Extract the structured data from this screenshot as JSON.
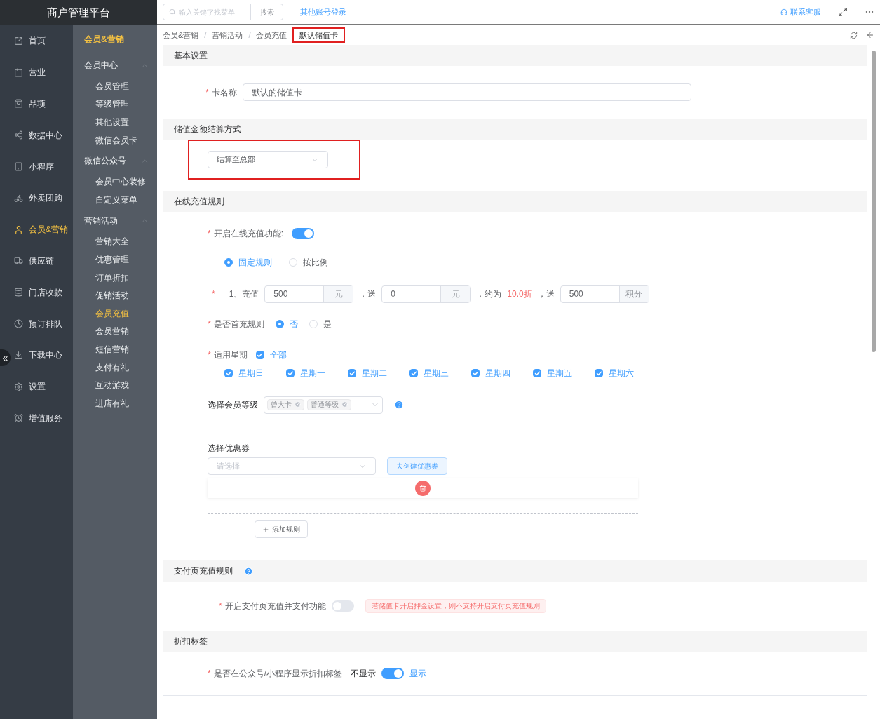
{
  "app_title": "商户管理平台",
  "required_mark": "*",
  "breadcrumb_separator": "/",
  "search": {
    "placeholder": "输入关键字找菜单",
    "button": "搜索"
  },
  "other_login": "其他账号登录",
  "support": "联系客服",
  "nav": [
    {
      "label": "首页",
      "selected": false
    },
    {
      "label": "营业",
      "selected": false
    },
    {
      "label": "品项",
      "selected": false
    },
    {
      "label": "数据中心",
      "selected": false
    },
    {
      "label": "小程序",
      "selected": false
    },
    {
      "label": "外卖团购",
      "selected": false
    },
    {
      "label": "会员&营销",
      "selected": true
    },
    {
      "label": "供应链",
      "selected": false
    },
    {
      "label": "门店收款",
      "selected": false
    },
    {
      "label": "预订排队",
      "selected": false
    },
    {
      "label": "下载中心",
      "selected": false
    },
    {
      "label": "设置",
      "selected": false
    },
    {
      "label": "增值服务",
      "selected": false
    }
  ],
  "collapse_glyph": "«",
  "submenu": {
    "title": "会员&营销",
    "groups": [
      {
        "label": "会员中心",
        "expanded": true,
        "children": [
          {
            "label": "会员管理",
            "selected": false
          },
          {
            "label": "等级管理",
            "selected": false
          },
          {
            "label": "其他设置",
            "selected": false
          },
          {
            "label": "微信会员卡",
            "selected": false
          }
        ]
      },
      {
        "label": "微信公众号",
        "expanded": true,
        "children": [
          {
            "label": "会员中心装修",
            "selected": false
          },
          {
            "label": "自定义菜单",
            "selected": false
          }
        ]
      },
      {
        "label": "营销活动",
        "expanded": true,
        "children": [
          {
            "label": "营销大全",
            "selected": false
          },
          {
            "label": "优惠管理",
            "selected": false
          },
          {
            "label": "订单折扣",
            "selected": false
          },
          {
            "label": "促销活动",
            "selected": false
          },
          {
            "label": "会员充值",
            "selected": true
          },
          {
            "label": "会员营销",
            "selected": false
          },
          {
            "label": "短信营销",
            "selected": false
          },
          {
            "label": "支付有礼",
            "selected": false
          },
          {
            "label": "互动游戏",
            "selected": false
          },
          {
            "label": "进店有礼",
            "selected": false
          }
        ]
      }
    ]
  },
  "breadcrumb": [
    "会员&营销",
    "营销活动",
    "会员充值",
    "默认储值卡"
  ],
  "basic": {
    "title": "基本设置",
    "card_name_label": "卡名称",
    "card_name": "默认的储值卡"
  },
  "settlement": {
    "title": "储值金额结算方式",
    "value": "结算至总部"
  },
  "online": {
    "title": "在线充值规则",
    "enable_label": "开启在线充值功能:",
    "enabled": true,
    "modes": [
      {
        "label": "固定规则",
        "selected": true
      },
      {
        "label": "按比例",
        "selected": false
      }
    ],
    "rule": {
      "index": "1、充值",
      "amount": "500",
      "unit": "元",
      "give_label": "，送",
      "give": "0",
      "give_unit": "元",
      "approx_label": "，约为",
      "discount": "10.0折",
      "points_label": "，送",
      "points": "500",
      "points_unit": "积分"
    },
    "first_label": "是否首充规则",
    "first_options": [
      {
        "label": "否",
        "selected": true
      },
      {
        "label": "是",
        "selected": false
      }
    ],
    "week_label": "适用星期",
    "all": {
      "label": "全部",
      "checked": true
    },
    "days": [
      {
        "label": "星期日",
        "checked": true
      },
      {
        "label": "星期一",
        "checked": true
      },
      {
        "label": "星期二",
        "checked": true
      },
      {
        "label": "星期三",
        "checked": true
      },
      {
        "label": "星期四",
        "checked": true
      },
      {
        "label": "星期五",
        "checked": true
      },
      {
        "label": "星期六",
        "checked": true
      }
    ],
    "level_label": "选择会员等级",
    "levels": [
      "曾大卡",
      "普通等级"
    ],
    "coupon_label": "选择优惠券",
    "coupon_placeholder": "请选择",
    "create_coupon": "去创建优惠券",
    "add_rule": "添加规则"
  },
  "paypage": {
    "title": "支付页充值规则",
    "enable_label": "开启支付页充值并支付功能",
    "enabled": false,
    "warning": "若储值卡开启押金设置，则不支持开启支付页充值规则"
  },
  "tag": {
    "title": "折扣标签",
    "label": "是否在公众号/小程序显示折扣标签",
    "off_label": "不显示",
    "on": true,
    "on_label": "显示"
  }
}
